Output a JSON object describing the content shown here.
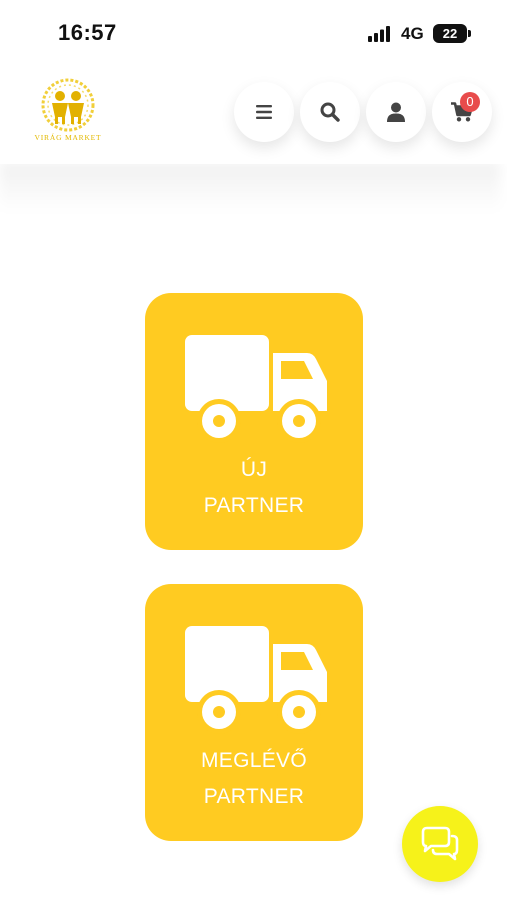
{
  "status_bar": {
    "time": "16:57",
    "network": "4G",
    "battery": "22"
  },
  "header": {
    "logo_text": "VIRÁG MARKET",
    "cart_count": "0",
    "icons": [
      "menu-icon",
      "search-icon",
      "user-icon",
      "cart-icon"
    ]
  },
  "tiles": [
    {
      "line1": "ÚJ",
      "line2": "PARTNER",
      "icon": "truck-icon"
    },
    {
      "line1": "MEGLÉVŐ",
      "line2": "PARTNER",
      "icon": "truck-icon"
    }
  ],
  "chat": {
    "icon": "chat-bubbles-icon"
  },
  "colors": {
    "tile": "#ffcb21",
    "chat": "#f6f21a",
    "badge": "#e84b4b",
    "logo": "#e3b900"
  }
}
